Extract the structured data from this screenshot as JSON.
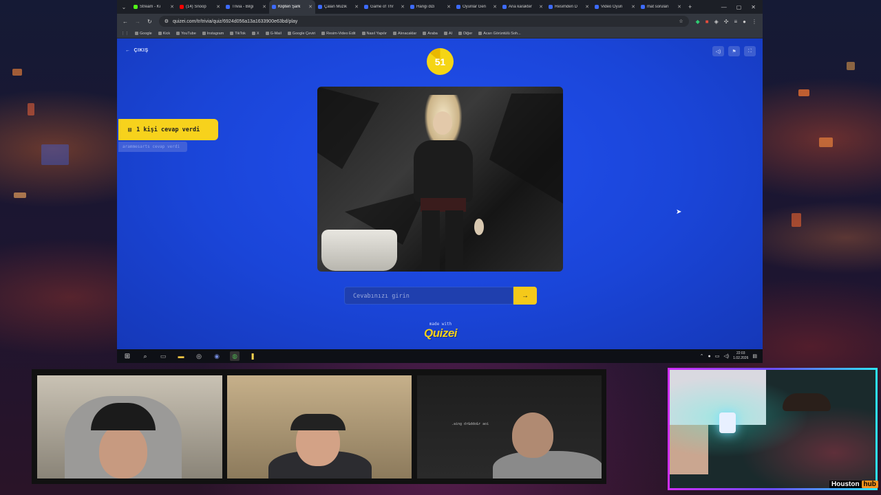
{
  "browser": {
    "tabs": [
      {
        "label": "Stream - Ki",
        "color": "#53fc18"
      },
      {
        "label": "(14) Snoop",
        "color": "#ff0000"
      },
      {
        "label": "Trivia - Bilgi",
        "color": "#3d6bff"
      },
      {
        "label": "Klipten Şark",
        "color": "#3d6bff",
        "active": true
      },
      {
        "label": "Çalan Müzik",
        "color": "#3d6bff"
      },
      {
        "label": "Game of Thr",
        "color": "#3d6bff"
      },
      {
        "label": "Hangi dizi",
        "color": "#3d6bff"
      },
      {
        "label": "Oyunlar Gen",
        "color": "#3d6bff"
      },
      {
        "label": "Ana karakter",
        "color": "#3d6bff"
      },
      {
        "label": "Resimden D",
        "color": "#3d6bff"
      },
      {
        "label": "Video Oyun",
        "color": "#3d6bff"
      },
      {
        "label": "mat soruları",
        "color": "#3d6bff"
      }
    ],
    "url": "quizei.com/tr/trivia/quiz/6924d056a13a1633900e63bd/play",
    "bookmarks": [
      "Google",
      "Kick",
      "YouTube",
      "Instagram",
      "TikTok",
      "X",
      "G-Mail",
      "Google Çeviri",
      "Resim-Video Edit",
      "Nasıl Yapılır",
      "Alınacaklar",
      "Araba",
      "AI",
      "Diğer",
      "Acarı Görüntülü Soh..."
    ]
  },
  "quiz": {
    "exit_label": "ÇIKIŞ",
    "timer": "51",
    "answered_badge": "1 kişi cevap verdi",
    "answered_sub": "arammesarts cevap verdi",
    "input_placeholder": "Cevabınızı girin",
    "submit_icon": "→",
    "made_with": "made with",
    "logo": "Quizei"
  },
  "taskbar": {
    "time": "22:03",
    "date": "1.02.2026"
  },
  "overlay": {
    "brand_left": "Houston",
    "brand_right": "hub",
    "cam3_text": ".aing dr&ddo&r aoi"
  }
}
